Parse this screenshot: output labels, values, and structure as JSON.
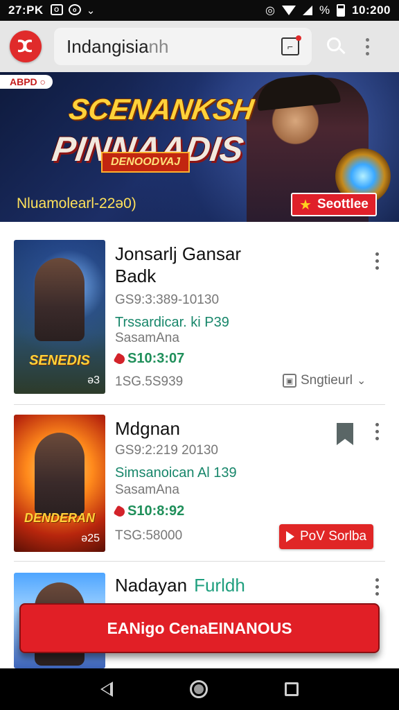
{
  "status_bar": {
    "time_left": "27:PK",
    "left_icons": [
      "O",
      "o"
    ],
    "battery_label": "%",
    "time_right": "10:200"
  },
  "app_bar": {
    "logo_glyph": "ⵋ",
    "search_query_main": "Indangisia",
    "search_query_dim": "nh"
  },
  "banner": {
    "ribbon": "ABPD ○",
    "title_line1": "SCENANKSH",
    "title_line2": "PINNAADIS",
    "tagline": "DENOODVAJ",
    "date_text": "Nluamolearl-22ə0)",
    "cta_label": "Seottlee"
  },
  "items": [
    {
      "title_line1": "Jonsarlj Gansar",
      "title_line2": "Badk",
      "code": "GS9:3:389-10130",
      "green_text": "Trssardicar. ki P39",
      "subtitle": "SasamAna",
      "price": "S10:3:07",
      "footer_text": "1SG.5S939",
      "thumb_caption": "SENEDIS",
      "thumb_number": "ə3",
      "ghost_label": "Sngtieurl"
    },
    {
      "title_line1": "Mdgnan",
      "code": "GS9:2:219 20130",
      "green_text": "Simsanoican Al 139",
      "subtitle": "SasamAna",
      "price": "S10:8:92",
      "footer_text": "TSG:58000",
      "thumb_caption": "DENDERAN",
      "thumb_number": "ə25",
      "chip_label": "PoV Sorlba"
    },
    {
      "title_line1": "Nadayan",
      "title_green": "Furldh"
    }
  ],
  "big_cta": {
    "label": "EANigo CenaEINANOUS"
  },
  "colors": {
    "accent_red": "#e11f26",
    "green_text": "#17866a",
    "banner_bg": "#1c2e66"
  },
  "icons": [
    "logo-icon",
    "notification-box-icon",
    "search-icon",
    "more-icon",
    "price-tag-icon",
    "bookmark-icon",
    "back-icon",
    "home-icon",
    "recents-icon"
  ]
}
